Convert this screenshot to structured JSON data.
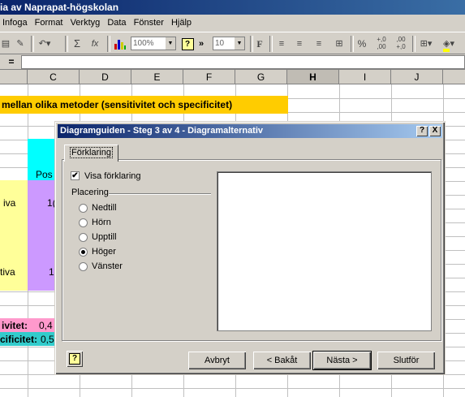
{
  "window": {
    "title": "ia av Naprapat-högskolan"
  },
  "menu": [
    "Infoga",
    "Format",
    "Verktyg",
    "Data",
    "Fönster",
    "Hjälp"
  ],
  "toolbar": {
    "zoom": "100%",
    "font_size": "10",
    "sum": "Σ",
    "fx": "fx",
    "bold": "F",
    "percent": "%",
    "dec_inc": "+,0\n,00",
    "dec_dec": ",00\n+,0"
  },
  "formula_bar": {
    "eq": "="
  },
  "columns": [
    "C",
    "D",
    "E",
    "F",
    "G",
    "H",
    "I",
    "J"
  ],
  "sheet": {
    "heading": "mellan olika metoder (sensitivitet och specificitet)",
    "pos": "Pos",
    "iva_1": "iva",
    "iva_2": "tiva",
    "val_1": "1(",
    "val_2": "1",
    "sens_label": "ivitet:",
    "sens_val": "0,4",
    "spec_label": "cificitet:",
    "spec_val": "0,52"
  },
  "dialog": {
    "title": "Diagramguiden - Steg 3 av 4 - Diagramalternativ",
    "help_btn": "?",
    "close_btn": "X",
    "tab": "Förklaring",
    "show_legend": "Visa förklaring",
    "show_legend_checked": true,
    "placement_group": "Placering",
    "options": [
      "Nedtill",
      "Hörn",
      "Upptill",
      "Höger",
      "Vänster"
    ],
    "selected_option": "Höger",
    "buttons": {
      "cancel": "Avbryt",
      "back": "< Bakåt",
      "next": "Nästa >",
      "finish": "Slutför"
    }
  },
  "colors": {
    "header_yellow": "#ffcc00",
    "cyan": "#00ffff",
    "light_yellow": "#ffff99",
    "lavender": "#cc99ff",
    "pink": "#ff99cc",
    "teal": "#33cccc"
  }
}
